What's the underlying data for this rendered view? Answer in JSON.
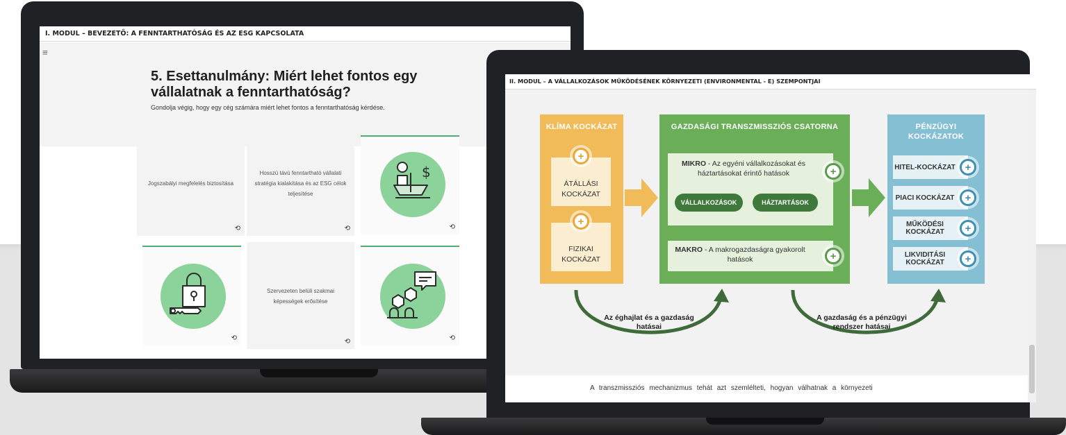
{
  "laptop1": {
    "module_title": "I. MODUL – BEVEZETŐ: A FENNTARTHATÓSÁG ÉS AZ ESG KAPCSOLATA",
    "menu_icon": "hamburger-icon",
    "case_title": "5. Esettanulmány: Miért lehet fontos egy vállalatnak a fenntarthatóság?",
    "case_subtitle": "Gondolja végig, hogy egy cég számára miért lehet fontos a fenntarthatóság kérdése.",
    "cards": {
      "c1": "Jogszabályi megfelelés biztosítása",
      "c2": "Hosszú távú fenntartható vállalati stratégia kialakítása és az ESG célok teljesítése",
      "c5": "Szervezeten belüli szakmai képességek erősítése"
    },
    "flip_icon": "⟲",
    "icons": [
      "scales-dollar-icon",
      "lock-key-icon",
      "people-chat-icon"
    ]
  },
  "laptop2": {
    "module_title": "II. MODUL – A VÁLLALKOZÁSOK MŰKÖDÉSÉNEK KÖRNYEZETI (ENVIRONMENTAL - E) SZEMPONTJAI",
    "climate": {
      "title": "KLÍMA KOCKÁZAT",
      "transition": "ÁTÁLLÁSI KOCKÁZAT",
      "physical": "FIZIKAI KOCKÁZAT"
    },
    "transmission": {
      "title": "GAZDASÁGI TRANSZMISSZIÓS CSATORNA",
      "micro_bold": "MIKRO",
      "micro_text": " - Az egyéni vállalkozásokat és háztartásokat érintő hatások",
      "pill_companies": "VÁLLALKOZÁSOK",
      "pill_households": "HÁZTARTÁSOK",
      "macro_bold": "MAKRO",
      "macro_text": " - A makrogazdaságra gyakorolt hatások"
    },
    "financial": {
      "title": "PÉNZÜGYI KOCKÁZATOK",
      "items": [
        "HITEL-KOCKÁZAT",
        "PIACI KOCKÁZAT",
        "MŰKÖDÉSI KOCKÁZAT",
        "LIKVIDITÁSI KOCKÁZAT"
      ]
    },
    "plus_symbol": "+",
    "arrow_left_label": "Az éghajlat és a gazdaság hatásai",
    "arrow_right_label": "A gazdaság és a pénzügyi rendszer hatásai",
    "footer_text": "A transzmissziós mechanizmus tehát azt szemlélteti, hogyan válhatnak a környezeti"
  },
  "colors": {
    "yellow": "#f0bb58",
    "green": "#6aae58",
    "blue": "#85bfd4",
    "dark_green": "#3f6b3a",
    "card_accent": "#4caf6e"
  }
}
